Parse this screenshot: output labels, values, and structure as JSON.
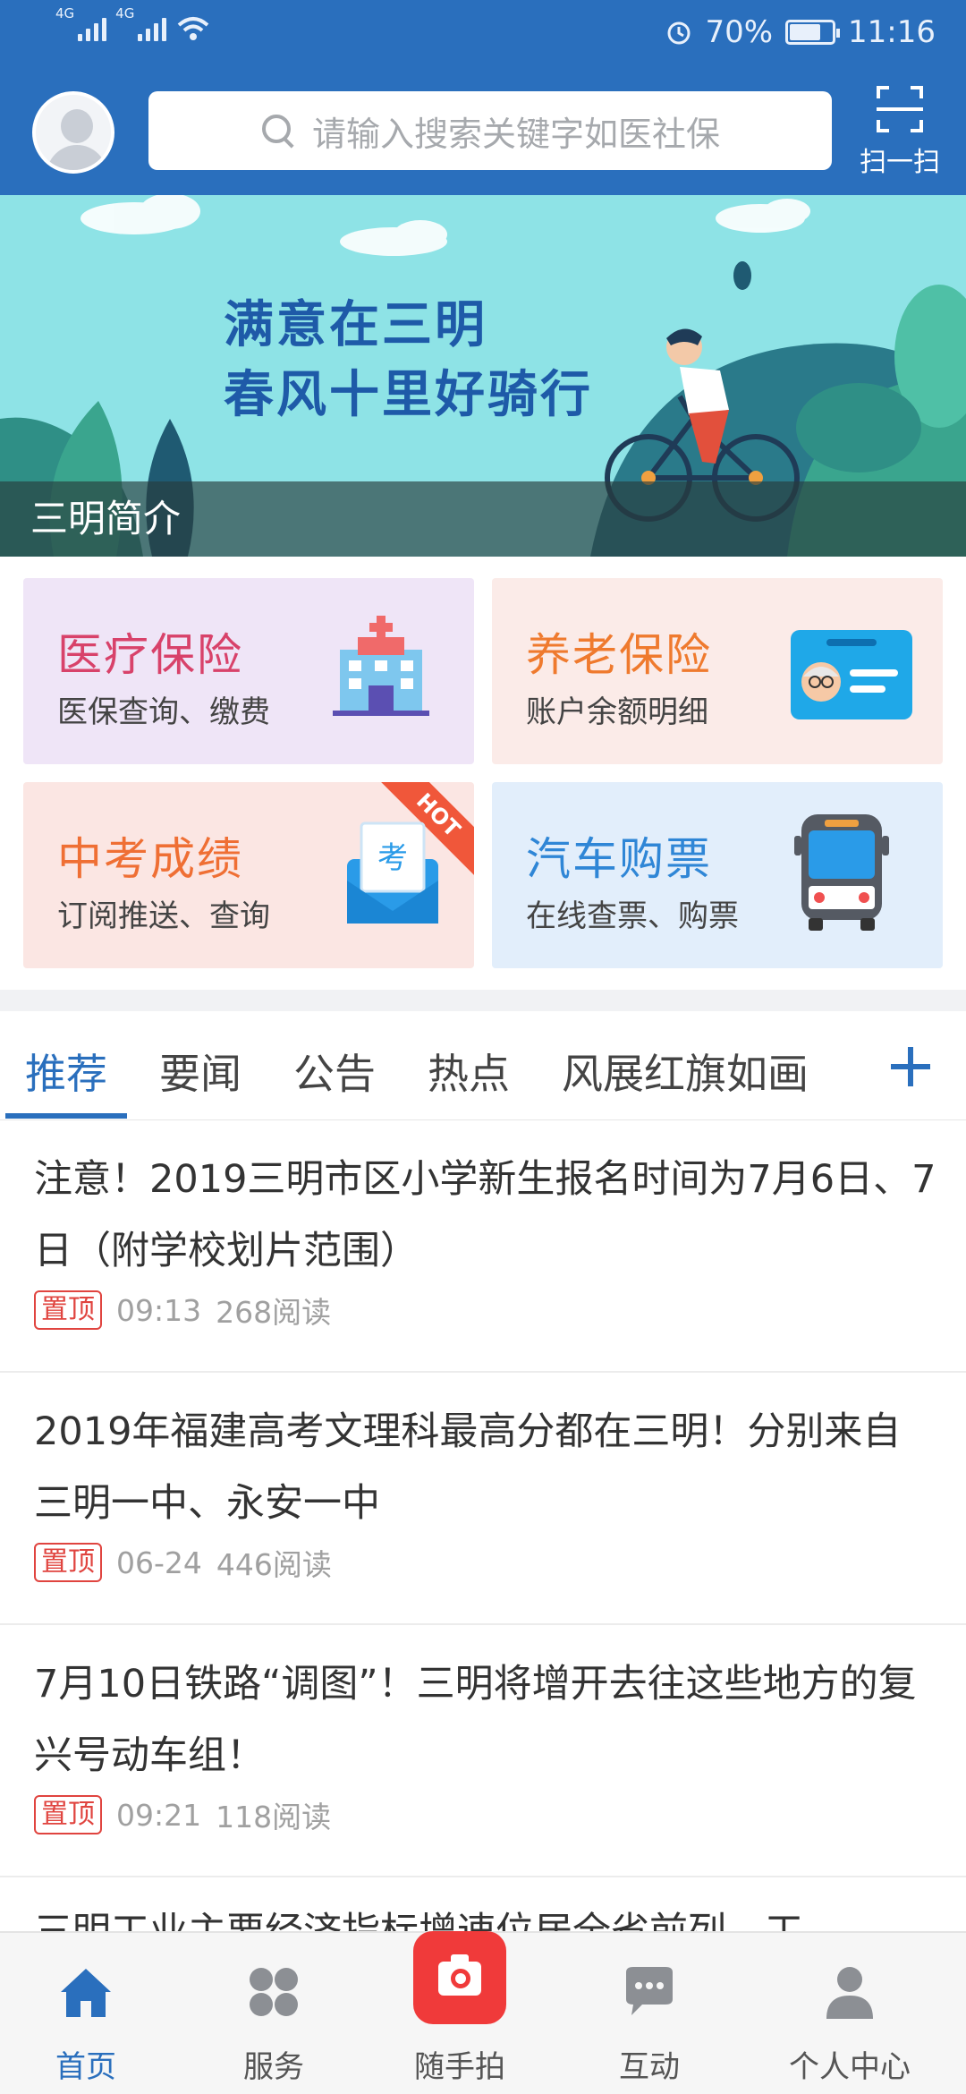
{
  "status_bar": {
    "signal_1": "4G",
    "signal_2": "4G",
    "battery": "70%",
    "time": "11:16"
  },
  "header": {
    "search_placeholder": "请输入搜索关键字如医社保",
    "scan_label": "扫一扫"
  },
  "banner": {
    "line1": "满意在三明",
    "line2": "春风十里好骑行",
    "caption": "三明简介"
  },
  "services": [
    {
      "title": "医疗保险",
      "subtitle": "医保查询、缴费",
      "icon": "hospital-icon"
    },
    {
      "title": "养老保险",
      "subtitle": "账户余额明细",
      "icon": "id-card-icon"
    },
    {
      "title": "中考成绩",
      "subtitle": "订阅推送、查询",
      "icon": "exam-icon",
      "badge": "HOT"
    },
    {
      "title": "汽车购票",
      "subtitle": "在线查票、购票",
      "icon": "bus-icon"
    }
  ],
  "tabs": [
    {
      "label": "推荐",
      "active": true
    },
    {
      "label": "要闻",
      "active": false
    },
    {
      "label": "公告",
      "active": false
    },
    {
      "label": "热点",
      "active": false
    },
    {
      "label": "风展红旗如画",
      "active": false
    }
  ],
  "news": [
    {
      "title": "注意！2019三明市区小学新生报名时间为7月6日、7日（附学校划片范围）",
      "tag": "置顶",
      "time": "09:13",
      "reads": "268阅读"
    },
    {
      "title": "2019年福建高考文理科最高分都在三明！分别来自三明一中、永安一中",
      "tag": "置顶",
      "time": "06-24",
      "reads": "446阅读"
    },
    {
      "title": "7月10日铁路“调图”！三明将增开去往这些地方的复兴号动车组！",
      "tag": "置顶",
      "time": "09:21",
      "reads": "118阅读"
    }
  ],
  "news_partial": "三明工业主要经济指标增速位居全省前列，工",
  "bottom_nav": [
    {
      "label": "首页",
      "icon": "home-icon",
      "active": true
    },
    {
      "label": "服务",
      "icon": "services-icon",
      "active": false
    },
    {
      "label": "随手拍",
      "icon": "camera-icon",
      "active": false
    },
    {
      "label": "互动",
      "icon": "chat-icon",
      "active": false
    },
    {
      "label": "个人中心",
      "icon": "person-icon",
      "active": false
    }
  ],
  "colors": {
    "brand": "#2a6fbd",
    "pin": "#e0443f",
    "camera": "#f03a3a"
  }
}
